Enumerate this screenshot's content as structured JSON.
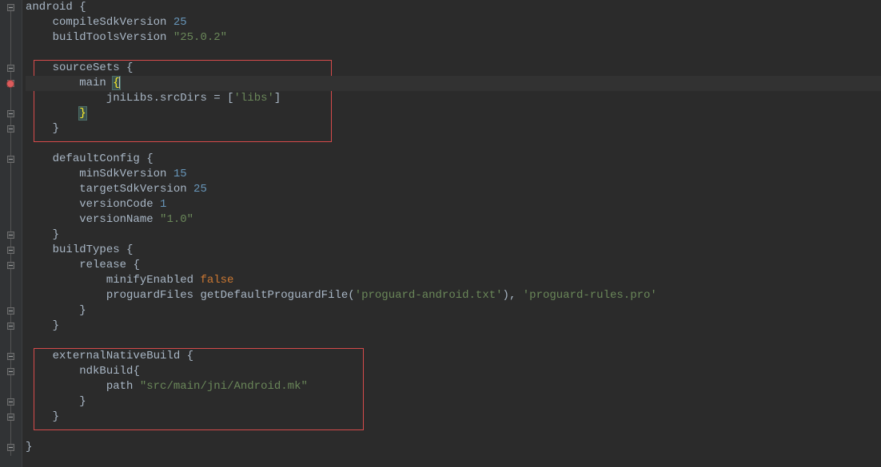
{
  "colors": {
    "bg": "#2b2b2b",
    "gutter": "#313335",
    "text": "#a9b7c6",
    "string": "#6a8759",
    "number": "#6897bb",
    "keyword": "#cc7832",
    "highlightBox": "#d64b4b"
  },
  "code": {
    "l1": {
      "ident": "android",
      "brace": "{"
    },
    "l2": {
      "ident": "compileSdkVersion",
      "val": "25"
    },
    "l3": {
      "ident": "buildToolsVersion",
      "val": "\"25.0.2\""
    },
    "l5": {
      "ident": "sourceSets",
      "brace": "{"
    },
    "l6": {
      "ident": "main",
      "brace": "{"
    },
    "l7": {
      "lhs": "jniLibs.srcDirs",
      "op": "=",
      "bracketL": "[",
      "val": "'libs'",
      "bracketR": "]"
    },
    "l8": {
      "brace": "}"
    },
    "l9": {
      "brace": "}"
    },
    "l11": {
      "ident": "defaultConfig",
      "brace": "{"
    },
    "l12": {
      "ident": "minSdkVersion",
      "val": "15"
    },
    "l13": {
      "ident": "targetSdkVersion",
      "val": "25"
    },
    "l14": {
      "ident": "versionCode",
      "val": "1"
    },
    "l15": {
      "ident": "versionName",
      "val": "\"1.0\""
    },
    "l16": {
      "brace": "}"
    },
    "l17": {
      "ident": "buildTypes",
      "brace": "{"
    },
    "l18": {
      "ident": "release",
      "brace": "{"
    },
    "l19": {
      "ident": "minifyEnabled",
      "val": "false"
    },
    "l20": {
      "ident": "proguardFiles",
      "fn": "getDefaultProguardFile",
      "arg1": "'proguard-android.txt'",
      "sep": "), ",
      "arg2": "'proguard-rules.pro'"
    },
    "l21": {
      "brace": "}"
    },
    "l22": {
      "brace": "}"
    },
    "l24": {
      "ident": "externalNativeBuild",
      "brace": "{"
    },
    "l25": {
      "ident": "ndkBuild",
      "brace": "{"
    },
    "l26": {
      "ident": "path",
      "val": "\"src/main/jni/Android.mk\""
    },
    "l27": {
      "brace": "}"
    },
    "l28": {
      "brace": "}"
    },
    "l30": {
      "brace": "}"
    }
  },
  "gutter": {
    "breakpointLine": 6
  }
}
